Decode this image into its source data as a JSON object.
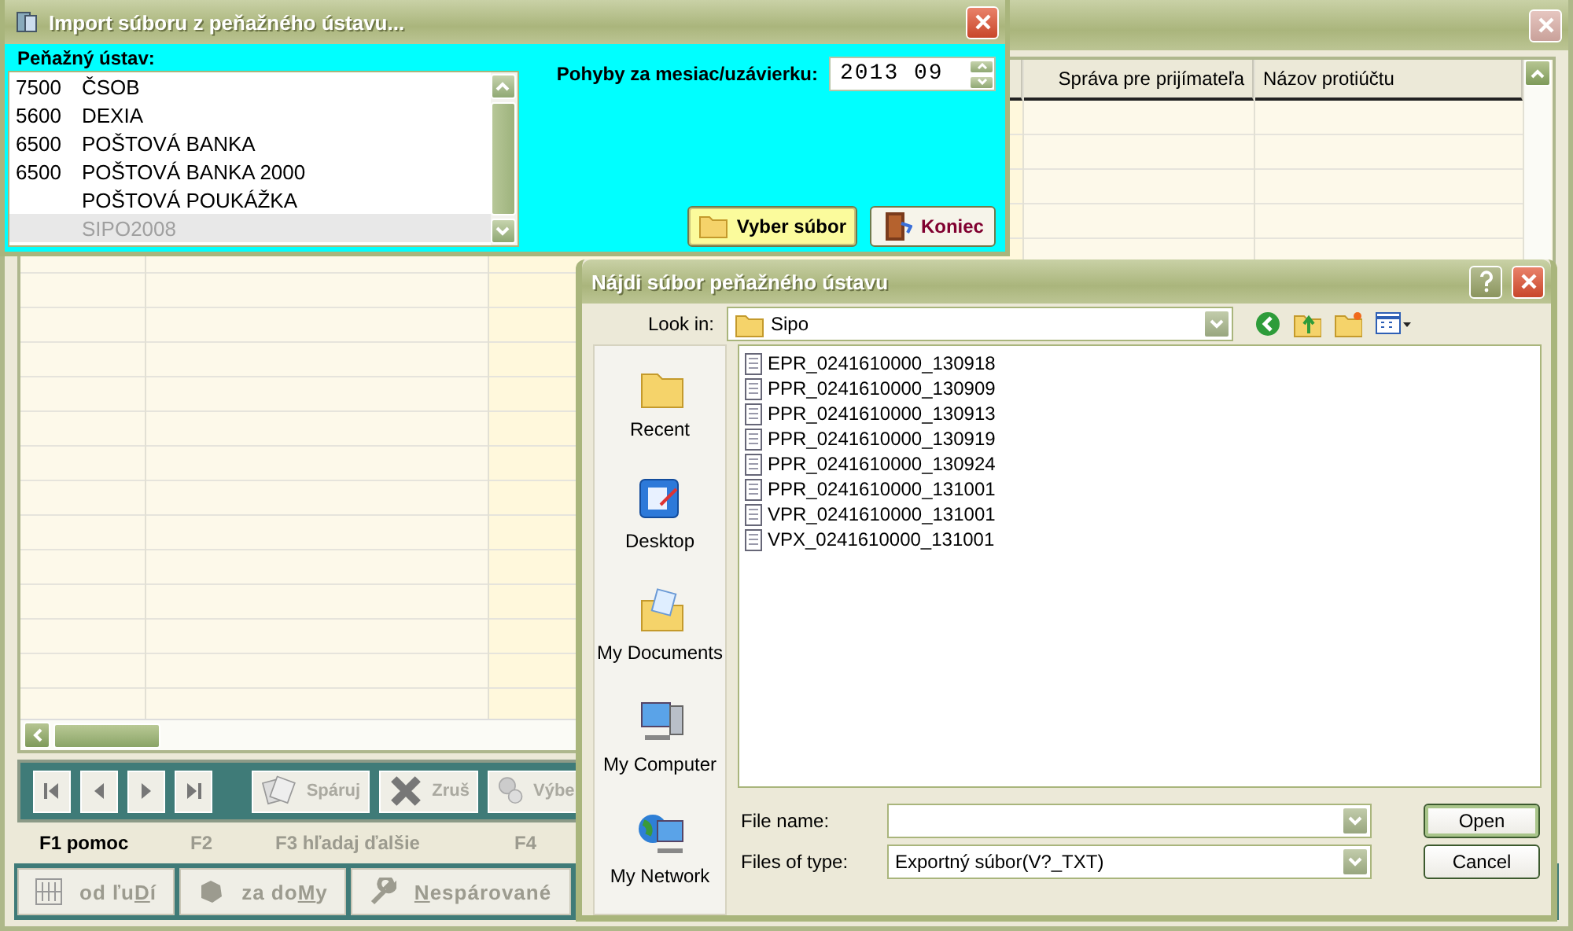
{
  "main_window": {
    "grid": {
      "columns": [
        {
          "label": "Správa pre prijímateľa"
        },
        {
          "label": "Názov protiúčtu"
        }
      ]
    },
    "toolbar": [
      {
        "kind": "pair",
        "label": "Spáruj",
        "disabled": true
      },
      {
        "kind": "cancel",
        "label": "Zruš",
        "disabled": true
      },
      {
        "kind": "select",
        "label": "Výbe",
        "disabled": true
      }
    ],
    "function_keys": [
      {
        "label": "F1 pomoc",
        "disabled": false
      },
      {
        "label": "F2",
        "disabled": true
      },
      {
        "label": "F3 hľadaj ďalšie",
        "disabled": true
      },
      {
        "label": "F4",
        "disabled": true
      }
    ],
    "bottom_tabs": [
      {
        "kind": "abacus",
        "before": "od ľu",
        "key": "D",
        "after": "í"
      },
      {
        "kind": "blob",
        "before": "za do",
        "key": "M",
        "after": "y"
      },
      {
        "kind": "wrench",
        "key": "N",
        "after": "espárované"
      }
    ]
  },
  "import_dialog": {
    "title": "Import súboru z peňažného ústavu...",
    "bank_label": "Peňažný ústav:",
    "banks": [
      {
        "code": "7500",
        "name": "ČSOB",
        "selected": false
      },
      {
        "code": "5600",
        "name": "DEXIA",
        "selected": false
      },
      {
        "code": "6500",
        "name": "POŠTOVÁ BANKA",
        "selected": false
      },
      {
        "code": "6500",
        "name": "POŠTOVÁ BANKA 2000",
        "selected": false
      },
      {
        "name": "POŠTOVÁ POUKÁŽKA",
        "selected": false
      },
      {
        "name": "SIPO2008",
        "selected": true
      }
    ],
    "period_label": "Pohyby za mesiac/uzávierku:",
    "period_value": "2013 09",
    "buttons": [
      {
        "kind": "folder",
        "label": "Vyber súbor",
        "focused": true
      },
      {
        "kind": "door",
        "label": "Koniec",
        "focused": false
      }
    ]
  },
  "file_dialog": {
    "title": "Nájdi súbor peňažného ústavu",
    "look_in_label": "Look in:",
    "look_in_value": "Sipo",
    "places": [
      {
        "kind": "recent",
        "label": "Recent"
      },
      {
        "kind": "desktop",
        "label": "Desktop"
      },
      {
        "kind": "documents",
        "label": "My Documents"
      },
      {
        "kind": "computer",
        "label": "My Computer"
      },
      {
        "kind": "network",
        "label": "My Network"
      }
    ],
    "files": [
      "EPR_0241610000_130918",
      "PPR_0241610000_130909",
      "PPR_0241610000_130913",
      "PPR_0241610000_130919",
      "PPR_0241610000_130924",
      "PPR_0241610000_131001",
      "VPR_0241610000_131001",
      "VPX_0241610000_131001"
    ],
    "file_name_label": "File name:",
    "files_of_type_label": "Files of type:",
    "files_of_type_value": "Exportný súbor(V?_TXT)",
    "buttons": [
      {
        "label": "Open",
        "default": true
      },
      {
        "label": "Cancel",
        "default": false
      }
    ]
  }
}
